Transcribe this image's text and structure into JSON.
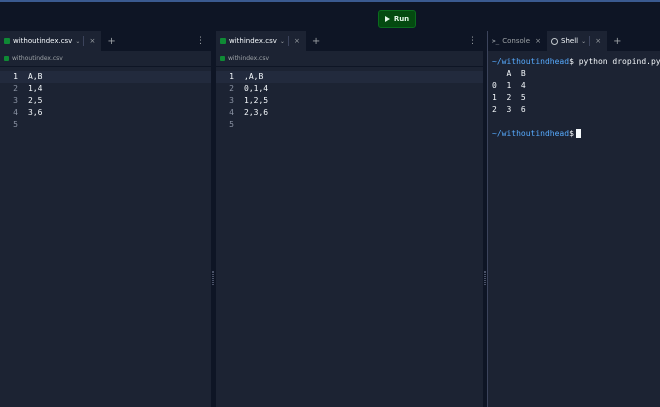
{
  "toolbar": {
    "run_label": "Run"
  },
  "pane1": {
    "tab_label": "withoutindex.csv",
    "path": "withoutindex.csv",
    "lines": [
      {
        "num": "1",
        "text": "A,B"
      },
      {
        "num": "2",
        "text": "1,4"
      },
      {
        "num": "3",
        "text": "2,5"
      },
      {
        "num": "4",
        "text": "3,6"
      },
      {
        "num": "5",
        "text": ""
      }
    ]
  },
  "pane2": {
    "tab_label": "withindex.csv",
    "path": "withindex.csv",
    "lines": [
      {
        "num": "1",
        "text": ",A,B"
      },
      {
        "num": "2",
        "text": "0,1,4"
      },
      {
        "num": "3",
        "text": "1,2,5"
      },
      {
        "num": "4",
        "text": "2,3,6"
      },
      {
        "num": "5",
        "text": ""
      }
    ]
  },
  "pane3": {
    "console_tab": "Console",
    "shell_tab": "Shell",
    "console_icon": ">_",
    "prompt_path": "~/withoutindhead",
    "prompt_symbol": "$",
    "command": " python dropind.py",
    "output": [
      "   A  B",
      "0  1  4",
      "1  2  5",
      "2  3  6"
    ]
  },
  "icons": {
    "close": "×",
    "plus": "+",
    "kebab": "⋮",
    "chevron": "⌄"
  },
  "colors": {
    "run_green": "#044a10",
    "file_icon": "#0f8a35",
    "prompt": "#57abff",
    "background": "#0e1525",
    "panel": "#1c2333"
  }
}
